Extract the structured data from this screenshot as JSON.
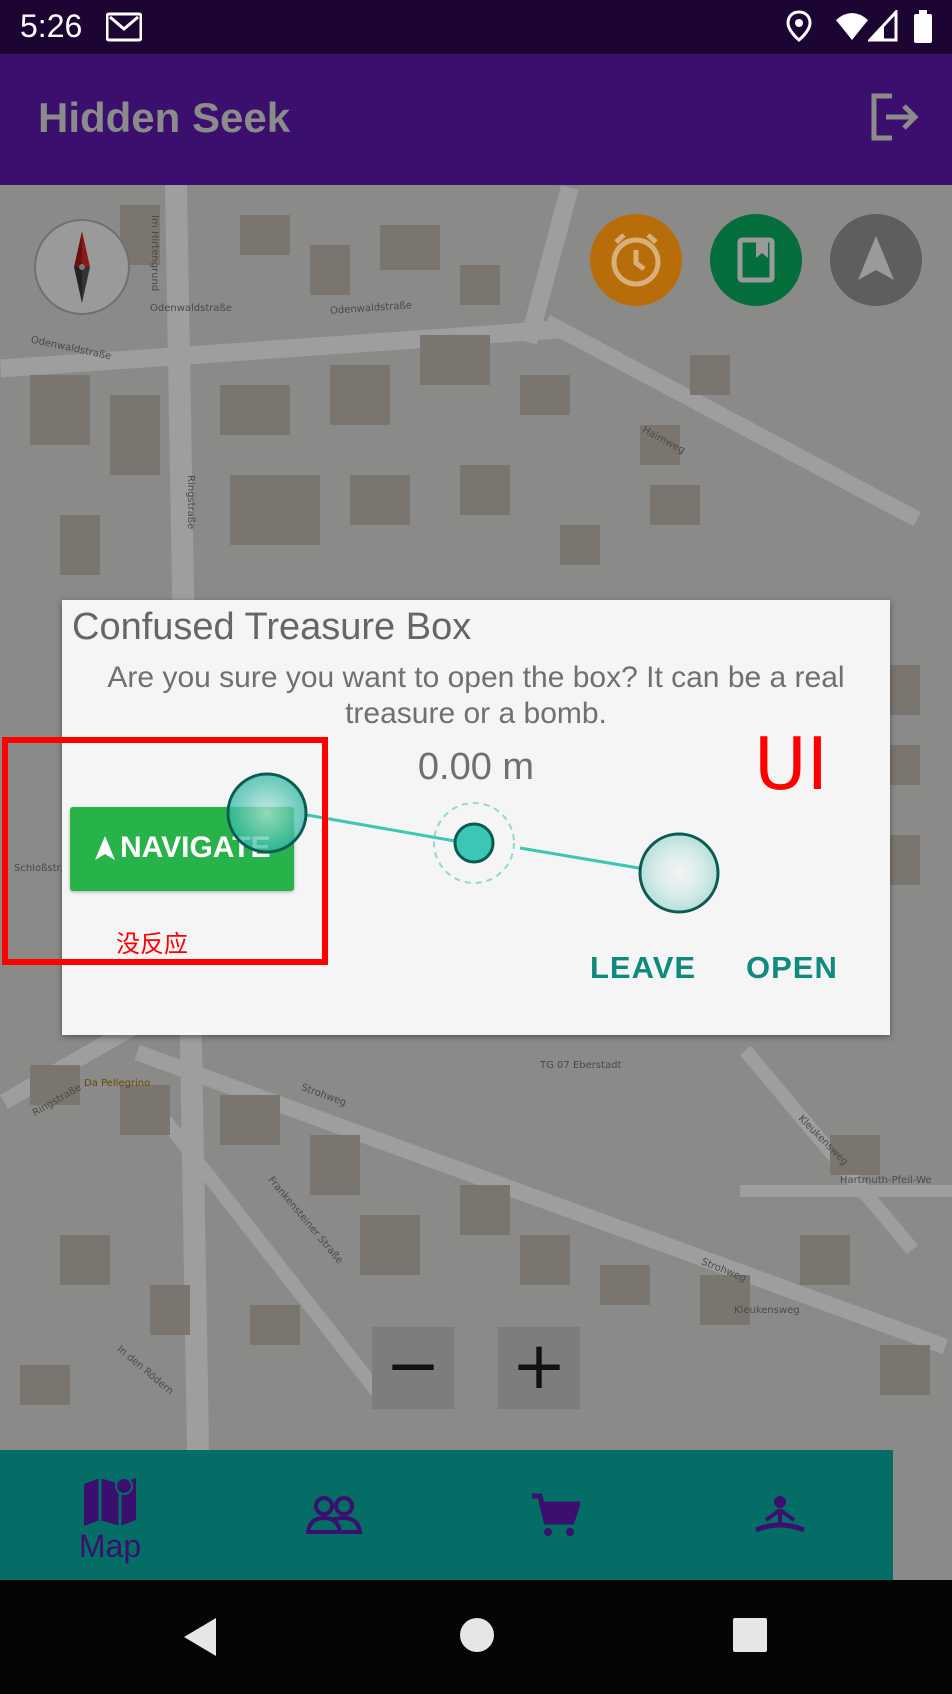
{
  "status_bar": {
    "time": "5:26"
  },
  "app_bar": {
    "title": "Hidden Seek"
  },
  "map": {
    "street_labels": [
      "Odenwaldstraße",
      "Odenwaldstraße",
      "Odenwaldstraße",
      "Im Hirtengrund",
      "Ringstraße",
      "Haimweg",
      "Schloßstr.",
      "Strohweg",
      "Strohweg",
      "Kleukensweg",
      "Hartmuth-Pfeil-We",
      "Frankensteiner Straße",
      "In den Rödern",
      "Ringstraße",
      "Da Pellegrino",
      "Kleukensweg",
      "TG 07 Eberstadt",
      "Odenwaldstraße"
    ],
    "zoom_out_label": "−",
    "zoom_in_label": "+"
  },
  "dialog": {
    "title": "Confused Treasure Box",
    "message": "Are you sure you want to open the box? It can be a real treasure or a bomb.",
    "distance": "0.00 m",
    "navigate_label": "NAVIGATE",
    "leave_label": "LEAVE",
    "open_label": "OPEN"
  },
  "annotation": {
    "note": "没反应",
    "ui_label": "UI",
    "color": "#ff0000"
  },
  "bottom_nav": {
    "items": [
      {
        "label": "Map",
        "icon": "map-icon",
        "active": true
      },
      {
        "label": "",
        "icon": "people-icon",
        "active": false
      },
      {
        "label": "",
        "icon": "cart-icon",
        "active": false
      },
      {
        "label": "",
        "icon": "meditation-icon",
        "active": false
      }
    ]
  },
  "colors": {
    "app_bar": "#3a0f6e",
    "bottom_nav": "#046e66",
    "navigate_button": "#27b34a",
    "dialog_action": "#0f8a7e",
    "alarm_fab": "#b76d09",
    "bookmark_fab": "#046e3c"
  }
}
